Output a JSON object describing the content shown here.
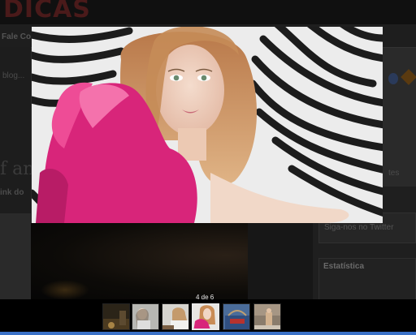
{
  "background_page": {
    "logo_text": "DICAS",
    "nav_link": "Fale Co",
    "left_texts": [
      "blog..."
    ],
    "headline_fragment": "f anim",
    "link_fragment": "ink do",
    "sidebar_fragment": "tes",
    "twitter_link": "Siga-nos no Twitter",
    "stats_title": "Estatística"
  },
  "lightbox": {
    "counter": "4 de 6",
    "main_image_icon": "photo-girl-pink-dress-zebra",
    "thumbnails": [
      {
        "icon": "thumb-dim-room"
      },
      {
        "icon": "thumb-pale-girl"
      },
      {
        "icon": "thumb-girl-light"
      },
      {
        "icon": "thumb-girl-pink",
        "active": true
      },
      {
        "icon": "thumb-blue-bag"
      },
      {
        "icon": "thumb-standing-woman"
      }
    ]
  },
  "colors": {
    "dress_pink": "#d8257a",
    "overlay": "#0a0a0a",
    "active_border": "#e8e8e8",
    "taskbar_blue": "#3b72c8"
  }
}
